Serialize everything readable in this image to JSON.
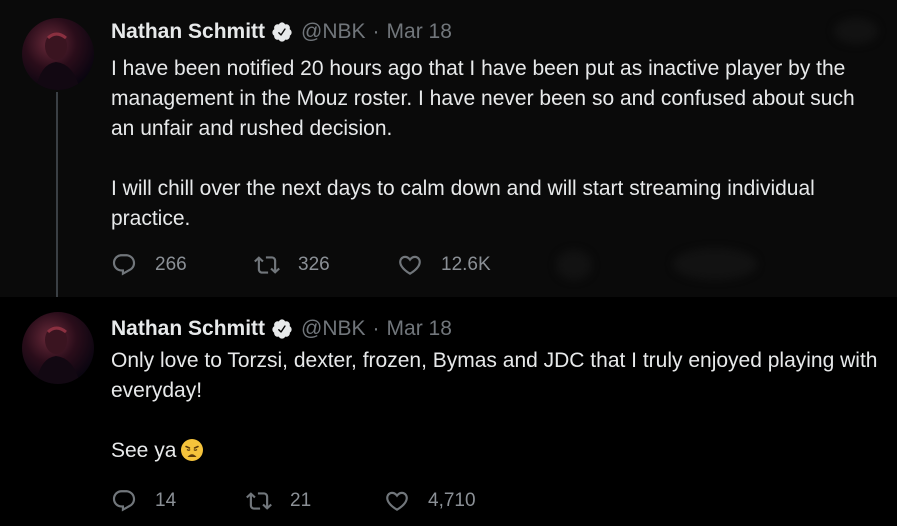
{
  "tweets": [
    {
      "author_name": "Nathan Schmitt",
      "handle": "@NBK",
      "separator": "·",
      "date": "Mar 18",
      "paragraphs": [
        "I have been notified 20 hours ago that I have been put as inactive player by the management in the Mouz roster. I have never been so and confused about such an unfair and rushed decision.",
        "I will chill over the next days to calm down and will start streaming individual practice."
      ],
      "replies": "266",
      "retweets": "326",
      "likes": "12.6K"
    },
    {
      "author_name": "Nathan Schmitt",
      "handle": "@NBK",
      "separator": "·",
      "date": "Mar 18",
      "paragraphs": [
        "Only love to Torzsi, dexter, frozen, Bymas and JDC that I truly enjoyed playing with everyday!",
        "See ya"
      ],
      "emoji": "weary-face-emoji",
      "replies": "14",
      "retweets": "21",
      "likes": "4,710"
    }
  ],
  "icons": {
    "reply": "reply-icon",
    "retweet": "retweet-icon",
    "like": "heart-icon",
    "verified": "verified-badge-icon",
    "more": "more-options-icon"
  },
  "colors": {
    "background": "#000000",
    "text": "#e7e9ea",
    "muted": "#71767b"
  }
}
